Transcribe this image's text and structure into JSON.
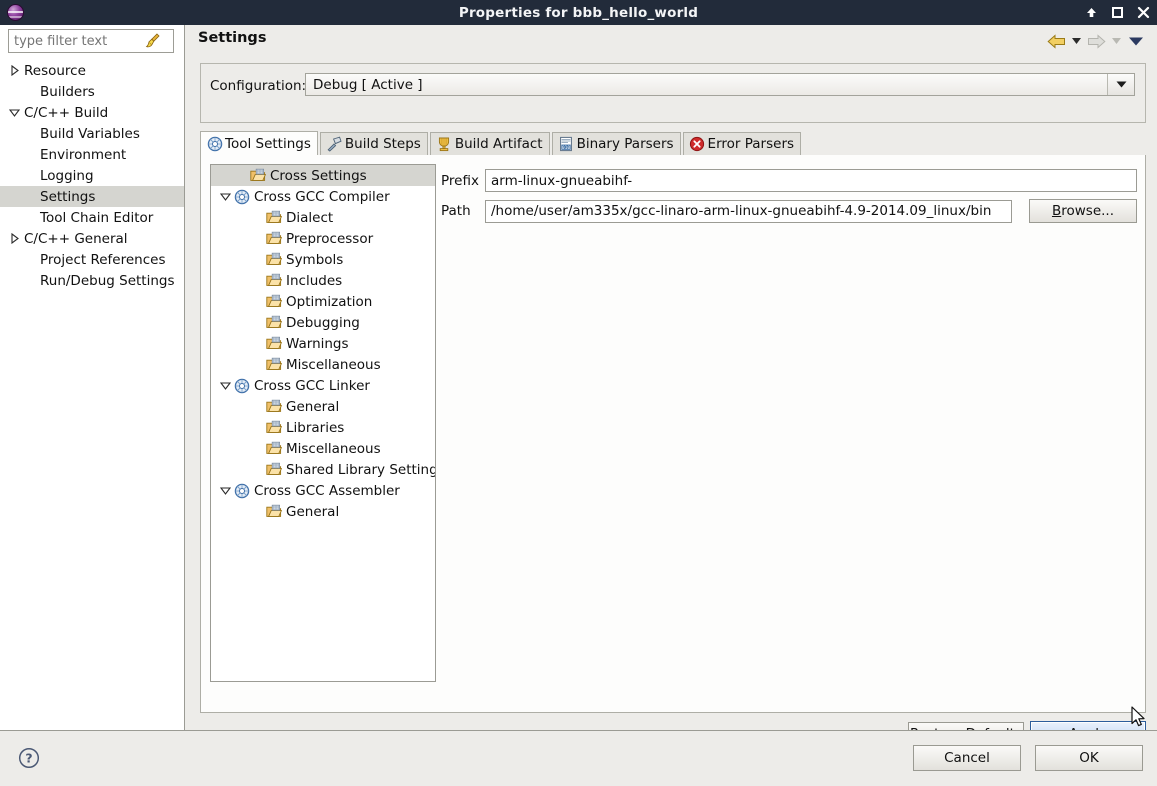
{
  "window": {
    "title": "Properties for bbb_hello_world",
    "app_icon": "eclipse-logo-icon",
    "controls": [
      {
        "name": "shade-button",
        "glyph": "up-arrow-icon"
      },
      {
        "name": "maximize-button",
        "glyph": "square-icon"
      },
      {
        "name": "close-button",
        "glyph": "close-icon"
      }
    ]
  },
  "sidebar": {
    "filter": {
      "value": "",
      "placeholder": "type filter text",
      "clear_icon": "broom-icon"
    },
    "items": [
      {
        "label": "Resource",
        "indent": 0,
        "twisty": "collapsed",
        "selected": false
      },
      {
        "label": "Builders",
        "indent": 1,
        "twisty": "none",
        "selected": false
      },
      {
        "label": "C/C++ Build",
        "indent": 0,
        "twisty": "expanded",
        "selected": false
      },
      {
        "label": "Build Variables",
        "indent": 1,
        "twisty": "none",
        "selected": false
      },
      {
        "label": "Environment",
        "indent": 1,
        "twisty": "none",
        "selected": false
      },
      {
        "label": "Logging",
        "indent": 1,
        "twisty": "none",
        "selected": false
      },
      {
        "label": "Settings",
        "indent": 1,
        "twisty": "none",
        "selected": true
      },
      {
        "label": "Tool Chain Editor",
        "indent": 1,
        "twisty": "none",
        "selected": false
      },
      {
        "label": "C/C++ General",
        "indent": 0,
        "twisty": "collapsed",
        "selected": false
      },
      {
        "label": "Project References",
        "indent": 1,
        "twisty": "none",
        "selected": false
      },
      {
        "label": "Run/Debug Settings",
        "indent": 1,
        "twisty": "none",
        "selected": false
      }
    ]
  },
  "header": {
    "title": "Settings",
    "nav": [
      {
        "name": "back-arrow-icon",
        "enabled": true
      },
      {
        "name": "back-dropdown-caret-icon",
        "enabled": true
      },
      {
        "name": "forward-arrow-icon",
        "enabled": false
      },
      {
        "name": "forward-dropdown-caret-icon",
        "enabled": false
      },
      {
        "name": "menu-caret-icon",
        "enabled": true
      }
    ]
  },
  "configuration": {
    "label": "Configuration:",
    "value": "Debug  [ Active ]",
    "dropdown_icon": "chevron-down-icon"
  },
  "tabs": [
    {
      "label": "Tool Settings",
      "icon": "tool-settings-icon",
      "active": true
    },
    {
      "label": "Build Steps",
      "icon": "hammer-icon",
      "active": false
    },
    {
      "label": "Build Artifact",
      "icon": "artifact-icon",
      "active": false
    },
    {
      "label": "Binary Parsers",
      "icon": "binary-doc-icon",
      "active": false
    },
    {
      "label": "Error Parsers",
      "icon": "error-icon",
      "active": false
    }
  ],
  "tool_tree": [
    {
      "label": "Cross Settings",
      "indent": 1,
      "twisty": "none",
      "icon": "folder-icon",
      "selected": true
    },
    {
      "label": "Cross GCC Compiler",
      "indent": 0,
      "twisty": "expanded",
      "icon": "tool-icon",
      "selected": false
    },
    {
      "label": "Dialect",
      "indent": 2,
      "twisty": "none",
      "icon": "folder-icon",
      "selected": false
    },
    {
      "label": "Preprocessor",
      "indent": 2,
      "twisty": "none",
      "icon": "folder-icon",
      "selected": false
    },
    {
      "label": "Symbols",
      "indent": 2,
      "twisty": "none",
      "icon": "folder-icon",
      "selected": false
    },
    {
      "label": "Includes",
      "indent": 2,
      "twisty": "none",
      "icon": "folder-icon",
      "selected": false
    },
    {
      "label": "Optimization",
      "indent": 2,
      "twisty": "none",
      "icon": "folder-icon",
      "selected": false
    },
    {
      "label": "Debugging",
      "indent": 2,
      "twisty": "none",
      "icon": "folder-icon",
      "selected": false
    },
    {
      "label": "Warnings",
      "indent": 2,
      "twisty": "none",
      "icon": "folder-icon",
      "selected": false
    },
    {
      "label": "Miscellaneous",
      "indent": 2,
      "twisty": "none",
      "icon": "folder-icon",
      "selected": false
    },
    {
      "label": "Cross GCC Linker",
      "indent": 0,
      "twisty": "expanded",
      "icon": "tool-icon",
      "selected": false
    },
    {
      "label": "General",
      "indent": 2,
      "twisty": "none",
      "icon": "folder-icon",
      "selected": false
    },
    {
      "label": "Libraries",
      "indent": 2,
      "twisty": "none",
      "icon": "folder-icon",
      "selected": false
    },
    {
      "label": "Miscellaneous",
      "indent": 2,
      "twisty": "none",
      "icon": "folder-icon",
      "selected": false
    },
    {
      "label": "Shared Library Settings",
      "indent": 2,
      "twisty": "none",
      "icon": "folder-icon",
      "selected": false
    },
    {
      "label": "Cross GCC Assembler",
      "indent": 0,
      "twisty": "expanded",
      "icon": "tool-icon",
      "selected": false
    },
    {
      "label": "General",
      "indent": 2,
      "twisty": "none",
      "icon": "folder-icon",
      "selected": false
    }
  ],
  "form": {
    "prefix": {
      "label": "Prefix",
      "value": "arm-linux-gnueabihf-"
    },
    "path": {
      "label": "Path",
      "value": "/home/user/am335x/gcc-linaro-arm-linux-gnueabihf-4.9-2014.09_linux/bin"
    },
    "browse": {
      "label": "Browse...",
      "mnemonic": "B"
    }
  },
  "page_buttons": {
    "restore_defaults": "Restore Defaults",
    "apply": "Apply"
  },
  "footer": {
    "help_icon": "help-icon",
    "cancel": "Cancel",
    "ok": "OK"
  },
  "colors": {
    "titlebar": "#222b3a",
    "dialog_bg": "#edece9",
    "selection": "#d5d5d0",
    "apply_border": "#2c5d9b",
    "apply_fill": "#b9d2f0",
    "folder_icon": "#e8a33d",
    "tool_icon": "#4a7fbf",
    "error_icon": "#cc2222"
  }
}
